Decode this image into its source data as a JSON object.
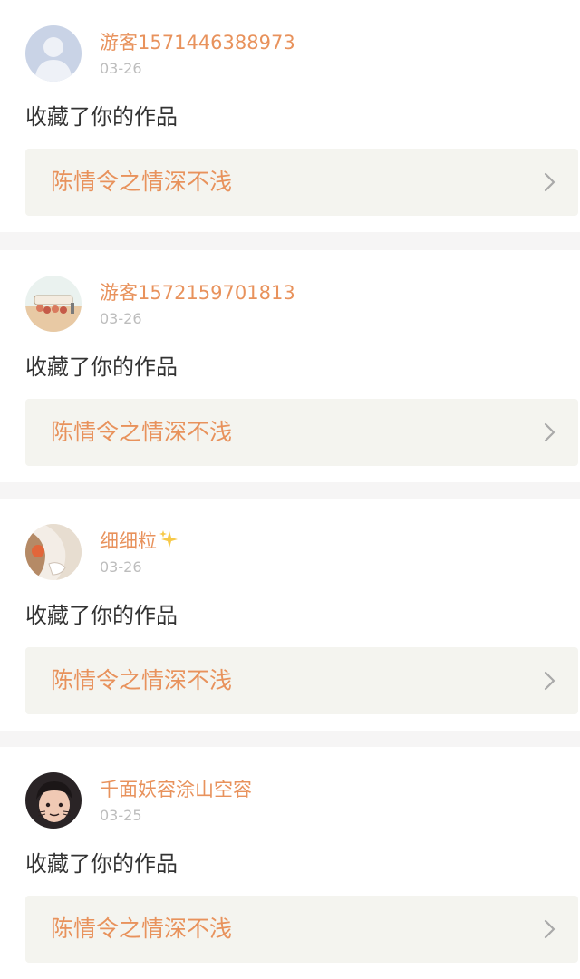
{
  "colors": {
    "accent": "#e8925c",
    "background": "#f6f5f5",
    "card": "#ffffff",
    "link_panel": "#f4f4ef",
    "muted": "#bdbdbd",
    "text": "#333333"
  },
  "notifications": [
    {
      "username": "游客1571446388973",
      "date": "03-26",
      "action": "收藏了你的作品",
      "work_title": "陈情令之情深不浅",
      "avatar": "default-person-avatar"
    },
    {
      "username": "游客1572159701813",
      "date": "03-26",
      "action": "收藏了你的作品",
      "work_title": "陈情令之情深不浅",
      "avatar": "cartoon-scene-avatar"
    },
    {
      "username": "细细粒",
      "username_emoji": "sparkles-icon",
      "date": "03-26",
      "action": "收藏了你的作品",
      "work_title": "陈情令之情深不浅",
      "avatar": "anime-girl-avatar"
    },
    {
      "username": "千面妖容涂山空容",
      "date": "03-25",
      "action": "收藏了你的作品",
      "work_title": "陈情令之情深不浅",
      "avatar": "child-photo-avatar"
    }
  ]
}
